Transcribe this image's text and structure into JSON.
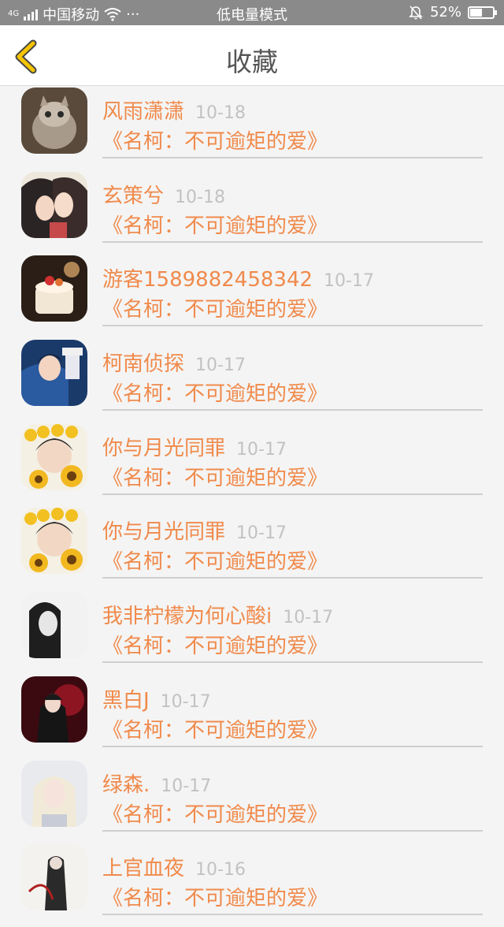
{
  "status_bar": {
    "signal_label": "4G",
    "carrier": "中国移动",
    "dots": "···",
    "mode": "低电量模式",
    "battery": "52%",
    "battery_level": 0.52,
    "icons": [
      "signal-icon",
      "wifi-icon",
      "bell-off-icon",
      "battery-icon"
    ]
  },
  "nav": {
    "title": "收藏",
    "back_icon": "chevron-left-icon",
    "accent": "#f5c400"
  },
  "colors": {
    "name": "#f08a4b",
    "date": "#c2c2c2",
    "separator": "#cfcfcf"
  },
  "items": [
    {
      "name": "风雨潇潇",
      "date": "10-18",
      "work": "《名柯：不可逾矩的爱》",
      "avatar": "cat-photo"
    },
    {
      "name": "玄策兮",
      "date": "10-18",
      "work": "《名柯：不可逾矩的爱》",
      "avatar": "anime-couple"
    },
    {
      "name": "游客1589882458342",
      "date": "10-17",
      "work": "《名柯：不可逾矩的爱》",
      "avatar": "cake-photo"
    },
    {
      "name": "柯南侦探",
      "date": "10-17",
      "work": "《名柯：不可逾矩的爱》",
      "avatar": "anime-blue"
    },
    {
      "name": "你与月光同罪",
      "date": "10-17",
      "work": "《名柯：不可逾矩的爱》",
      "avatar": "anime-sunflower"
    },
    {
      "name": "你与月光同罪",
      "date": "10-17",
      "work": "《名柯：不可逾矩的爱》",
      "avatar": "anime-sunflower"
    },
    {
      "name": "我非柠檬为何心酸i",
      "date": "10-17",
      "work": "《名柯：不可逾矩的爱》",
      "avatar": "girl-bw"
    },
    {
      "name": "黑白J",
      "date": "10-17",
      "work": "《名柯：不可逾矩的爱》",
      "avatar": "anime-red"
    },
    {
      "name": "绿森.",
      "date": "10-17",
      "work": "《名柯：不可逾矩的爱》",
      "avatar": "girl-blonde"
    },
    {
      "name": "上官血夜",
      "date": "10-16",
      "work": "《名柯：不可逾矩的爱》",
      "avatar": "ink-figure"
    }
  ]
}
